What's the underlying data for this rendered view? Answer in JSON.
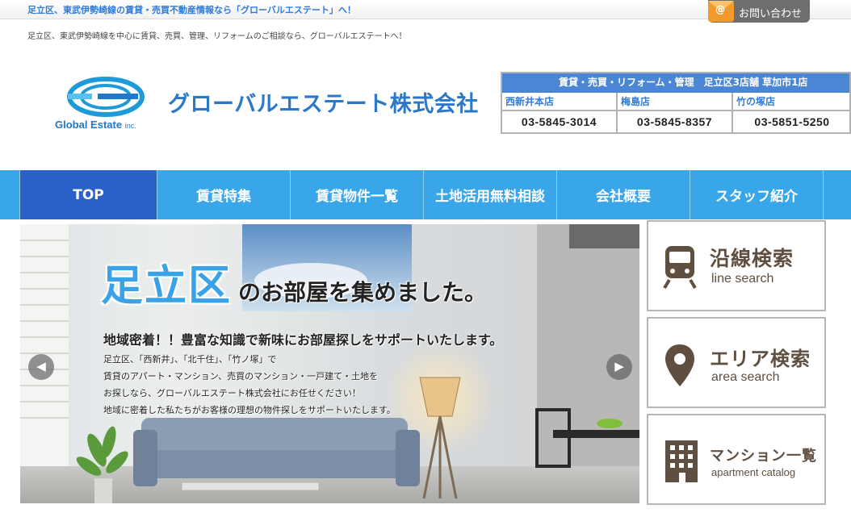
{
  "header": {
    "top_title": "足立区、東武伊勢崎線の賃貸・売買不動産情報なら「グローバルエステート」へ！",
    "contact_label": "お問い合わせ",
    "contact_icon": "mail-at-icon",
    "subline": "足立区、東武伊勢崎線を中心に賃貸、売買、管理、リフォームのご相談なら、グローバルエステートへ！"
  },
  "logo": {
    "english": "Global Estate",
    "english_suffix": "inc.",
    "japanese": "グローバルエステート株式会社",
    "brand_color": "#2c77c6"
  },
  "stores": {
    "heading": "賃貸・売買・リフォーム・管理　足立区3店舗 草加市1店",
    "list": [
      {
        "name": "西新井本店",
        "tel": "03-5845-3014"
      },
      {
        "name": "梅島店",
        "tel": "03-5845-8357"
      },
      {
        "name": "竹の塚店",
        "tel": "03-5851-5250"
      }
    ]
  },
  "nav": {
    "items": [
      {
        "label": "TOP"
      },
      {
        "label": "賃貸特集"
      },
      {
        "label": "賃貸物件一覧"
      },
      {
        "label": "土地活用無料相談"
      },
      {
        "label": "会社概要"
      },
      {
        "label": "スタッフ紹介"
      }
    ],
    "bar_color": "#39a6ea",
    "active_color": "#2a60c8"
  },
  "hero": {
    "big": "足立区",
    "rest": "のお部屋を集めました。",
    "lead": "地域密着！！豊富な知識で新味にお部屋探しをサポートいたします。",
    "lines": [
      "足立区、「西新井」、「北千住」、「竹ノ塚」で",
      "賃貸のアパート・マンション、売買のマンション・一戸建て・土地を",
      "お探しなら、グローバルエステート株式会社にお任せください！",
      "地域に密着した私たちがお客様の理想の物件探しをサポートいたします。"
    ],
    "prev_glyph": "◀",
    "next_glyph": "▶"
  },
  "side": {
    "line": {
      "jp": "沿線検索",
      "en": "line search",
      "icon": "train-icon"
    },
    "area": {
      "jp": "エリア検索",
      "en": "area search",
      "icon": "map-pin-icon"
    },
    "apartment": {
      "jp": "マンション一覧",
      "en": "apartment catalog",
      "icon": "building-icon"
    },
    "text_color": "#5f4f40"
  }
}
